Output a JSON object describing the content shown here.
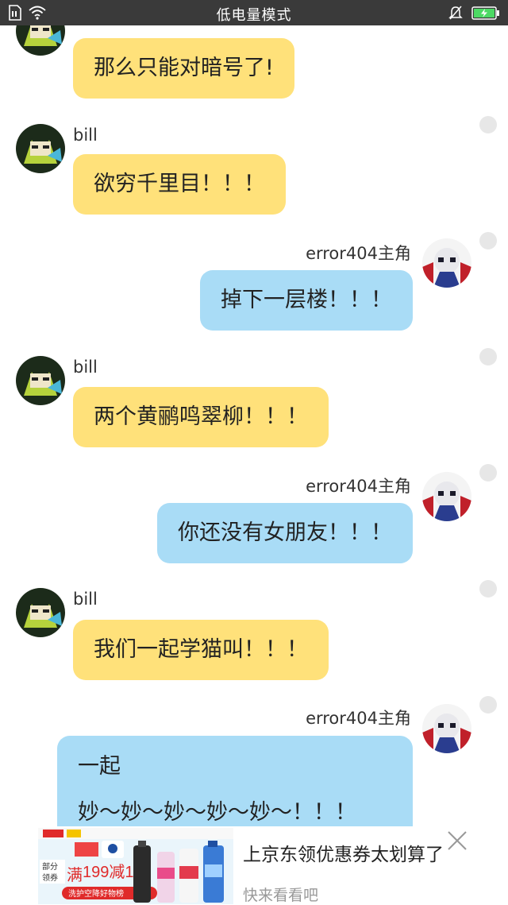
{
  "status_bar": {
    "title": "低电量模式",
    "icons": [
      "sim-icon",
      "wifi-icon",
      "mute-bell-icon",
      "battery-charging-icon"
    ],
    "battery_color": "#4cd964"
  },
  "colors": {
    "incoming_bubble": "#ffe17a",
    "outgoing_bubble": "#a9dcf6",
    "status_bar": "#3a3a3a"
  },
  "messages": [
    {
      "sender": "",
      "text": "那么只能对暗号了!"
    },
    {
      "sender": "bill",
      "text": "欲穷千里目！！！"
    },
    {
      "sender": "error404主角",
      "text": "掉下一层楼！！！"
    },
    {
      "sender": "bill",
      "text": "两个黄鹂鸣翠柳！！！"
    },
    {
      "sender": "error404主角",
      "text": "你还没有女朋友！！！"
    },
    {
      "sender": "bill",
      "text": "我们一起学猫叫！！！"
    },
    {
      "sender": "error404主角",
      "lines": [
        "一起",
        "妙～妙～妙～妙～妙～！！！"
      ]
    }
  ],
  "ad": {
    "title": "上京东领优惠券太划算了",
    "subtitle": "快来看看吧",
    "banner": {
      "badge": "部分\n领券",
      "promo_prefix": "满",
      "promo_amount": "199减110",
      "tagline": "洗护空降好物榜"
    }
  }
}
